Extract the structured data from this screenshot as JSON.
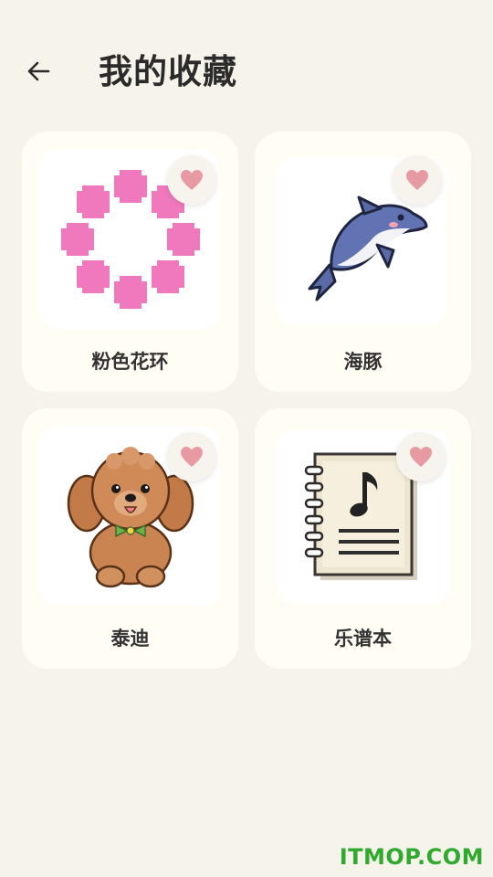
{
  "header": {
    "back_icon": "arrow-left-icon",
    "title": "我的收藏"
  },
  "favorites": [
    {
      "name": "粉色花环",
      "image": "pink-pixel-wreath",
      "favorited": true
    },
    {
      "name": "海豚",
      "image": "pixel-dolphin",
      "favorited": true
    },
    {
      "name": "泰迪",
      "image": "pixel-teddy-dog",
      "favorited": true
    },
    {
      "name": "乐谱本",
      "image": "pixel-music-notebook",
      "favorited": true
    }
  ],
  "colors": {
    "background": "#f6f3ea",
    "card": "#fffdf4",
    "heart": "#e89aa3",
    "watermark": "#2faa2f"
  },
  "watermark": "ITMOP.COM"
}
